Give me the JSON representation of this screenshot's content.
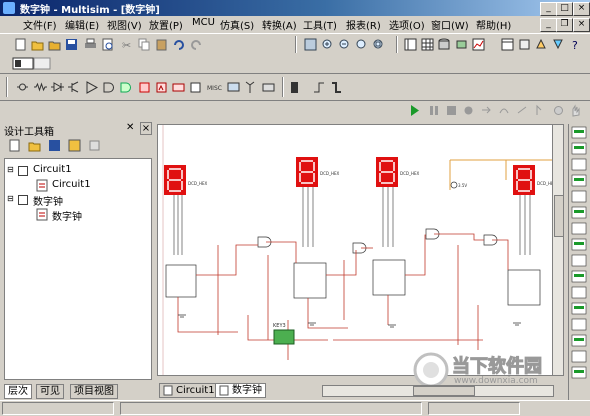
{
  "window": {
    "title": "数字钟 - Multisim - [数字钟]",
    "controls": [
      "_",
      "□",
      "×"
    ]
  },
  "menu": [
    "文件(F)",
    "编辑(E)",
    "视图(V)",
    "放置(P)",
    "MCU",
    "仿真(S)",
    "转换(A)",
    "工具(T)",
    "报表(R)",
    "选项(O)",
    "窗口(W)",
    "帮助(H)"
  ],
  "design_toolbox": {
    "title": "设计工具箱",
    "tree": [
      {
        "label": "Circuit1",
        "children": [
          "Circuit1"
        ]
      },
      {
        "label": "数字钟",
        "children": [
          "数字钟"
        ]
      }
    ],
    "bottom_tabs": [
      "层次",
      "可见",
      "项目视图"
    ]
  },
  "sheet_tabs": [
    "Circuit1",
    "数字钟"
  ],
  "schematic": {
    "display_labels": [
      "DCD_HEX",
      "DCD_HEX",
      "DCD_HEX",
      "DCD_HEX"
    ],
    "component_label": "KEY3",
    "power_label": "3.5V"
  },
  "watermark": {
    "brand": "当下软件园",
    "url": "www.downxia.com"
  },
  "colors": {
    "titlebar_start": "#0a246a",
    "titlebar_end": "#a6caf0",
    "wire": "#c0392b",
    "display_red": "#e01010"
  }
}
